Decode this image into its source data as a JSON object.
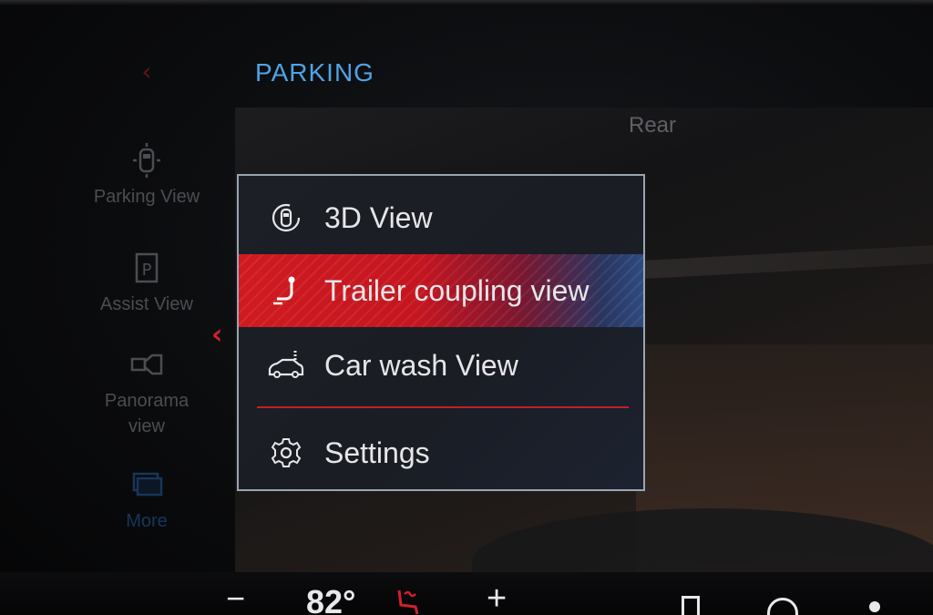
{
  "header": {
    "title": "PARKING",
    "back_icon": "chevron-left-icon"
  },
  "camera": {
    "label": "Rear"
  },
  "sidebar": {
    "items": [
      {
        "label": "Parking View",
        "icon": "car-topdown-icon"
      },
      {
        "label": "Assist View",
        "icon": "parking-p-icon"
      },
      {
        "label": "Panorama view",
        "label_line1": "Panorama",
        "label_line2": "view",
        "icon": "camera-icon"
      },
      {
        "label": "More",
        "icon": "stacked-windows-icon"
      }
    ],
    "open_indicator_icon": "chevron-left-icon"
  },
  "popup": {
    "items": [
      {
        "label": "3D View",
        "icon": "car-rotate-icon",
        "active": false
      },
      {
        "label": "Trailer coupling view",
        "icon": "trailer-hitch-icon",
        "active": true
      },
      {
        "label": "Car wash View",
        "icon": "car-wash-icon",
        "active": false
      },
      {
        "label": "Settings",
        "icon": "gear-icon",
        "active": false
      }
    ],
    "active_color": "#d01a20",
    "border_color": "#9aa5b0"
  },
  "climate": {
    "minus_label": "−",
    "temperature": "82°",
    "plus_label": "+",
    "seat_icon": "heated-seat-icon"
  },
  "colors": {
    "accent_blue": "#4fa3e6",
    "accent_red": "#d3202c"
  }
}
